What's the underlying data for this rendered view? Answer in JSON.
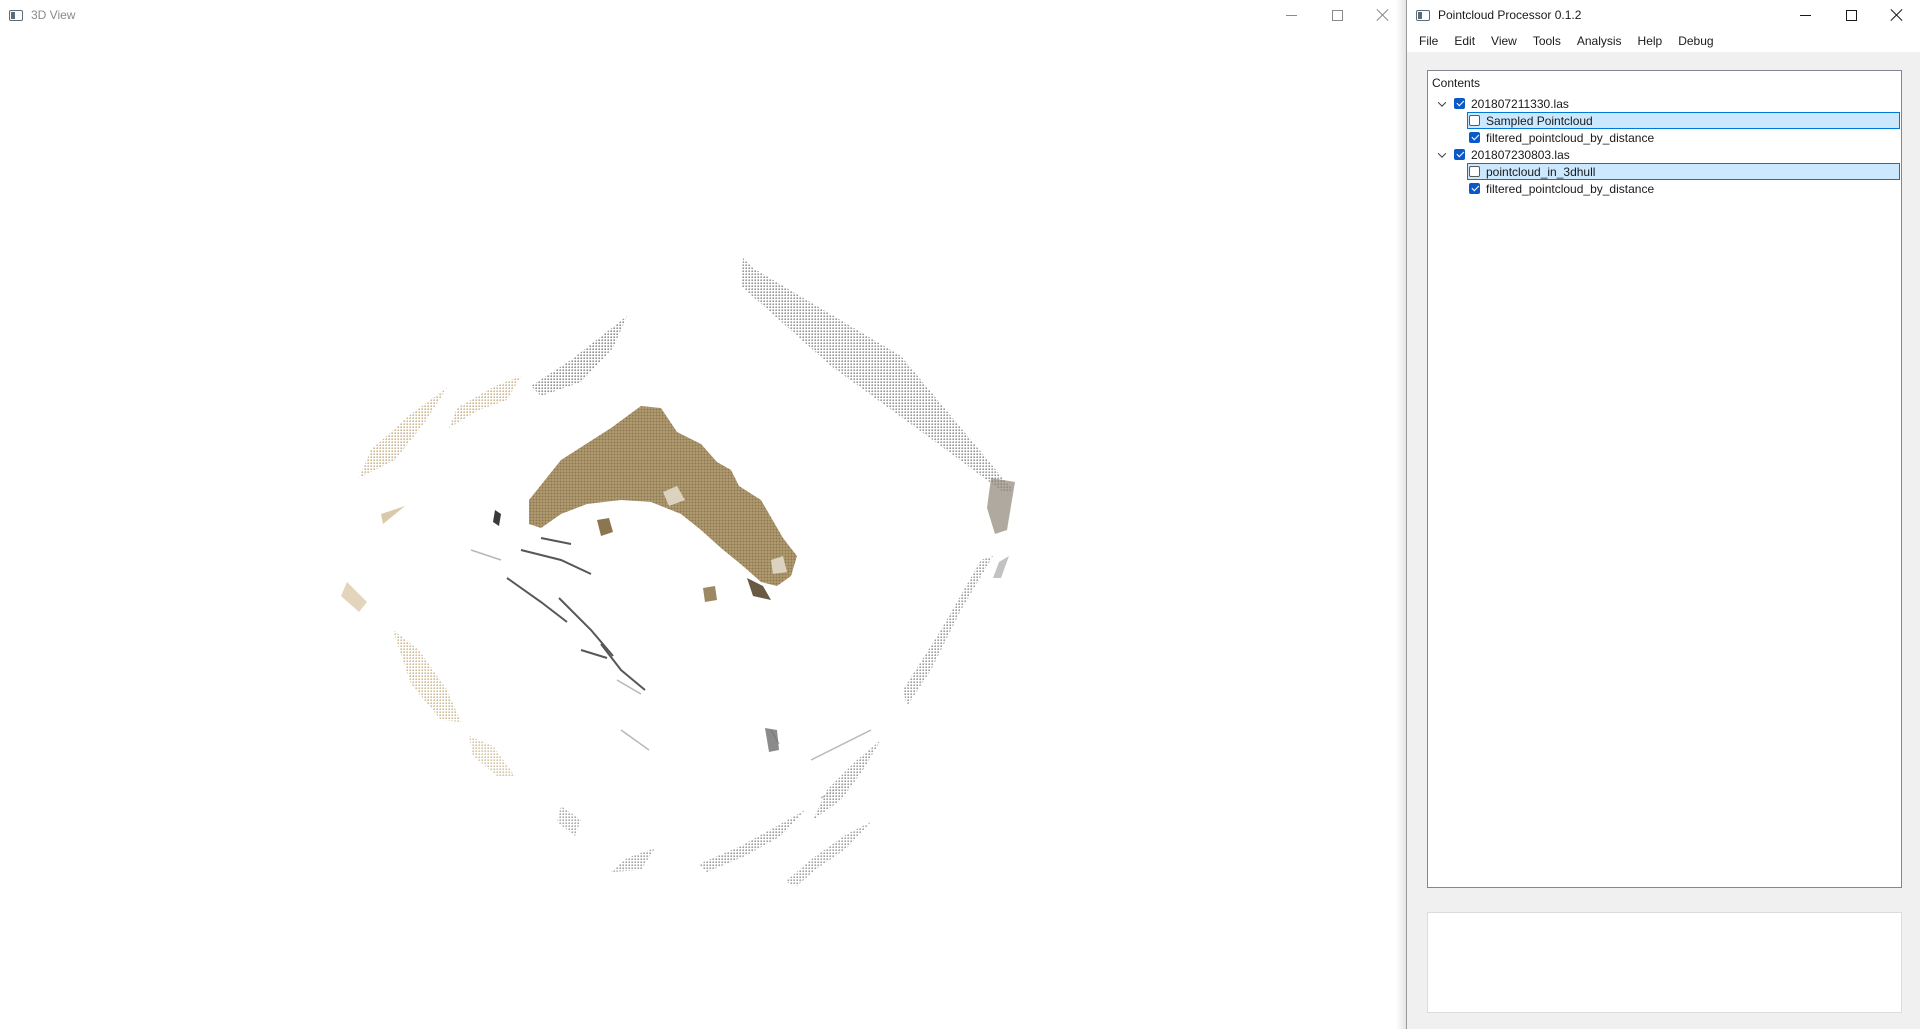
{
  "view3d": {
    "title": "3D View",
    "scene": {
      "main_object_color": "#a58f66",
      "wall_color": "#8a8a8a",
      "sand_color": "#c8b48e",
      "dark_color": "#3a3a3a"
    }
  },
  "processor": {
    "title": "Pointcloud Processor 0.1.2",
    "menu": [
      "File",
      "Edit",
      "View",
      "Tools",
      "Analysis",
      "Help",
      "Debug"
    ],
    "contents_header": "Contents",
    "tree": [
      {
        "label": "201807211330.las",
        "checked": true,
        "expanded": true,
        "children": [
          {
            "label": "Sampled Pointcloud",
            "checked": false,
            "selected": true
          },
          {
            "label": "filtered_pointcloud_by_distance",
            "checked": true,
            "selected": false
          }
        ]
      },
      {
        "label": "201807230803.las",
        "checked": true,
        "expanded": true,
        "children": [
          {
            "label": "pointcloud_in_3dhull",
            "checked": false,
            "selected": true
          },
          {
            "label": "filtered_pointcloud_by_distance",
            "checked": true,
            "selected": false
          }
        ]
      }
    ]
  }
}
